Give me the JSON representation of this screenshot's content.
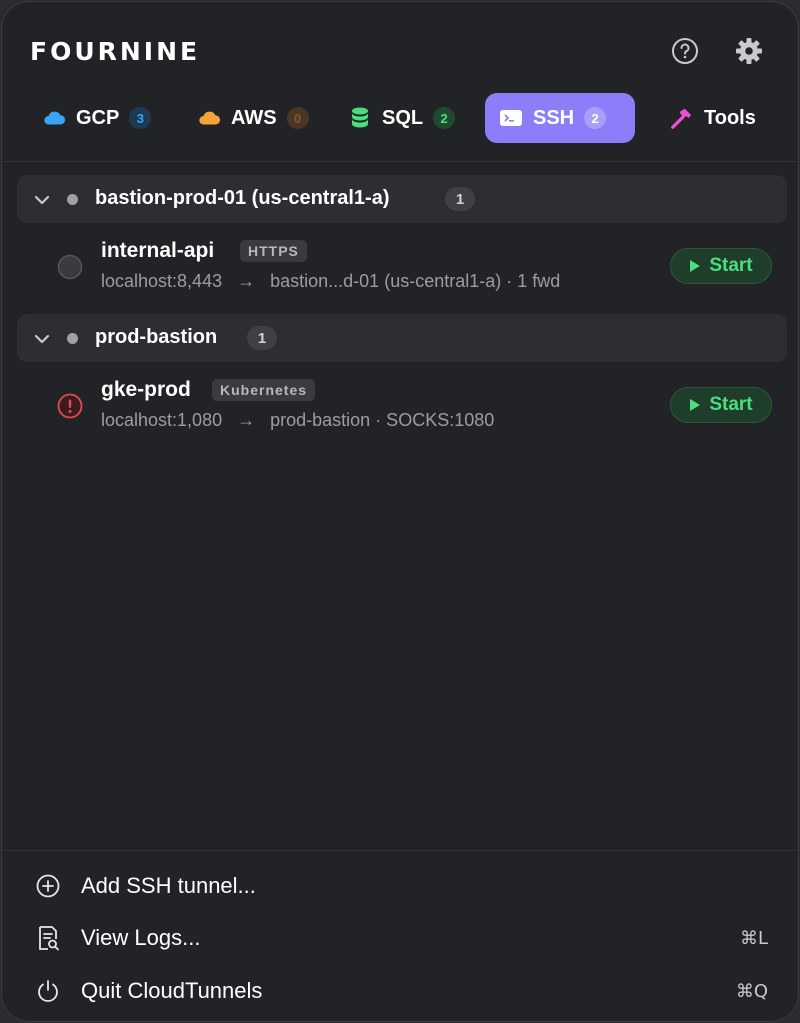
{
  "app": {
    "logo": "FOURNINE"
  },
  "tabs": [
    {
      "label": "GCP",
      "badge": "3",
      "icon": "cloud-icon",
      "color": "#3ba3f5",
      "active": false
    },
    {
      "label": "AWS",
      "badge": "0",
      "icon": "cloud-icon",
      "color": "#f5a33b",
      "active": false
    },
    {
      "label": "SQL",
      "badge": "2",
      "icon": "database-icon",
      "color": "#4ade80",
      "active": false
    },
    {
      "label": "SSH",
      "badge": "2",
      "icon": "terminal-icon",
      "color": "#ffffff",
      "active": true
    },
    {
      "label": "Tools",
      "icon": "hammer-icon",
      "color": "#f04fd1",
      "active": false
    }
  ],
  "groups": [
    {
      "title": "bastion-prod-01 (us-central1-a)",
      "count": "1",
      "tunnels": [
        {
          "name": "internal-api",
          "tag": "HTTPS",
          "local": "localhost:8,443",
          "target": "bastion...d-01 (us-central1-a) · 1 fwd",
          "status": "idle",
          "action": "Start"
        }
      ]
    },
    {
      "title": "prod-bastion",
      "count": "1",
      "tunnels": [
        {
          "name": "gke-prod",
          "tag": "Kubernetes",
          "local": "localhost:1,080",
          "target": "prod-bastion · SOCKS:1080",
          "status": "error",
          "action": "Start"
        }
      ]
    }
  ],
  "footer": {
    "add": {
      "label": "Add SSH tunnel..."
    },
    "logs": {
      "label": "View Logs...",
      "shortcut": "⌘L"
    },
    "quit": {
      "label": "Quit CloudTunnels",
      "shortcut": "⌘Q"
    }
  },
  "colors": {
    "accent": "#8b7ef8",
    "start_green": "#4ade80",
    "error_red": "#e5484d"
  }
}
